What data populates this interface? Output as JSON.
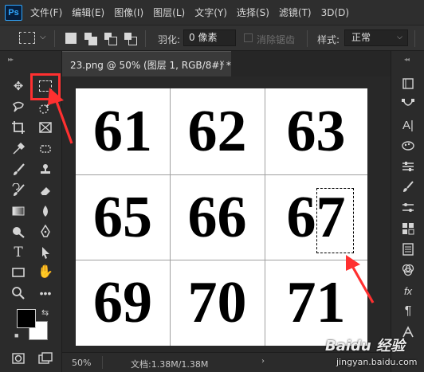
{
  "app": {
    "logo": "Ps",
    "accent_color": "#31a8ff",
    "annotation_color": "#ff3030"
  },
  "menu": [
    "文件(F)",
    "编辑(E)",
    "图像(I)",
    "图层(L)",
    "文字(Y)",
    "选择(S)",
    "滤镜(T)",
    "3D(D)"
  ],
  "options_bar": {
    "feather_label": "羽化:",
    "feather_value": "0 像素",
    "anti_alias_label": "消除锯齿",
    "anti_alias_checked": false,
    "style_label": "样式:",
    "style_value": "正常",
    "selection_mode": "new-selection"
  },
  "document_tab": {
    "title": "23.png @ 50% (图层 1, RGB/8#) *",
    "close": "×"
  },
  "canvas": {
    "cells": [
      "61",
      "62",
      "63",
      "65",
      "66",
      "67",
      "69",
      "70",
      "71"
    ],
    "grid_columns": 3,
    "grid_rows": 3
  },
  "status_bar": {
    "zoom": "50%",
    "doc_info": "文档:1.38M/1.38M",
    "arrow": "›"
  },
  "left_tools": [
    "move-tool-icon",
    "rectangular-marquee-tool-icon",
    "lasso-tool-icon",
    "quick-selection-tool-icon",
    "crop-tool-icon",
    "frame-tool-icon",
    "eyedropper-tool-icon",
    "spot-healing-brush-icon",
    "brush-tool-icon",
    "clone-stamp-tool-icon",
    "history-brush-icon",
    "eraser-tool-icon",
    "gradient-tool-icon",
    "blur-tool-icon",
    "dodge-tool-icon",
    "pen-tool-icon",
    "type-tool-icon",
    "path-selection-tool-icon",
    "rectangle-tool-icon",
    "hand-tool-icon",
    "zoom-tool-icon",
    "more-tools-icon",
    "quick-mask-icon",
    "screen-mode-icon"
  ],
  "colors": {
    "foreground": "#000000",
    "background": "#ffffff"
  },
  "watermark": {
    "text": "Baidu 经验",
    "url": "jingyan.baidu.com"
  }
}
